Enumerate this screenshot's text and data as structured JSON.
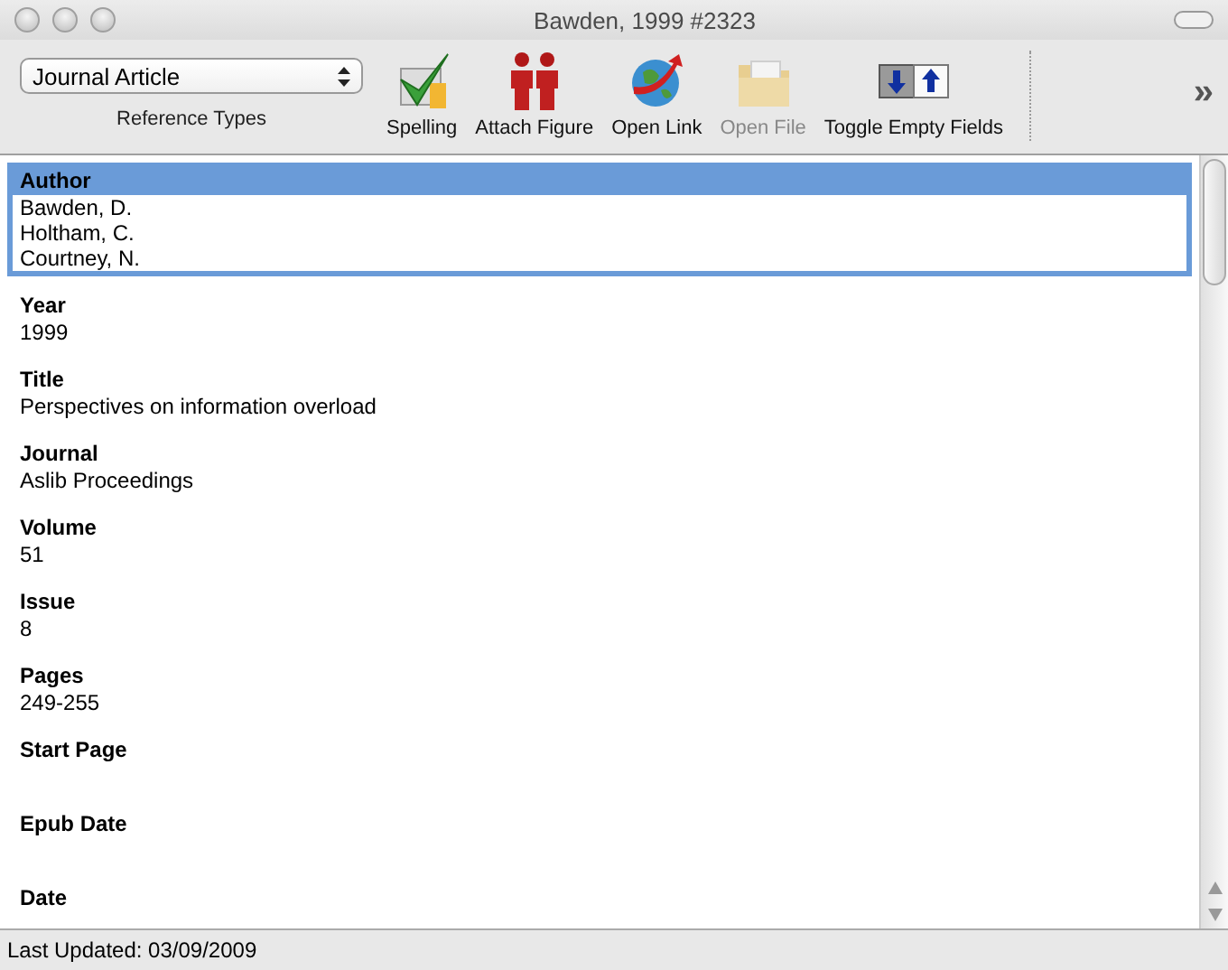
{
  "window": {
    "title": "Bawden, 1999 #2323"
  },
  "toolbar": {
    "reference_type": {
      "value": "Journal Article",
      "label": "Reference Types"
    },
    "items": [
      {
        "kind": "spelling",
        "label": "Spelling",
        "disabled": false
      },
      {
        "kind": "figure",
        "label": "Attach Figure",
        "disabled": false
      },
      {
        "kind": "link",
        "label": "Open Link",
        "disabled": false
      },
      {
        "kind": "file",
        "label": "Open File",
        "disabled": true
      },
      {
        "kind": "toggle",
        "label": "Toggle Empty Fields",
        "disabled": false
      }
    ],
    "overflow": "»"
  },
  "fields": [
    {
      "label": "Author",
      "lines": [
        "Bawden, D.",
        "Holtham, C.",
        "Courtney, N."
      ],
      "selected": true
    },
    {
      "label": "Year",
      "lines": [
        "1999"
      ],
      "selected": false
    },
    {
      "label": "Title",
      "lines": [
        "Perspectives on information overload"
      ],
      "selected": false
    },
    {
      "label": "Journal",
      "lines": [
        "Aslib Proceedings"
      ],
      "selected": false
    },
    {
      "label": "Volume",
      "lines": [
        "51"
      ],
      "selected": false
    },
    {
      "label": "Issue",
      "lines": [
        "8"
      ],
      "selected": false
    },
    {
      "label": "Pages",
      "lines": [
        "249-255"
      ],
      "selected": false
    },
    {
      "label": "Start Page",
      "selected": false
    },
    {
      "label": "Epub Date",
      "selected": false
    },
    {
      "label": "Date",
      "selected": false
    }
  ],
  "status_bar": "Last Updated: 03/09/2009"
}
